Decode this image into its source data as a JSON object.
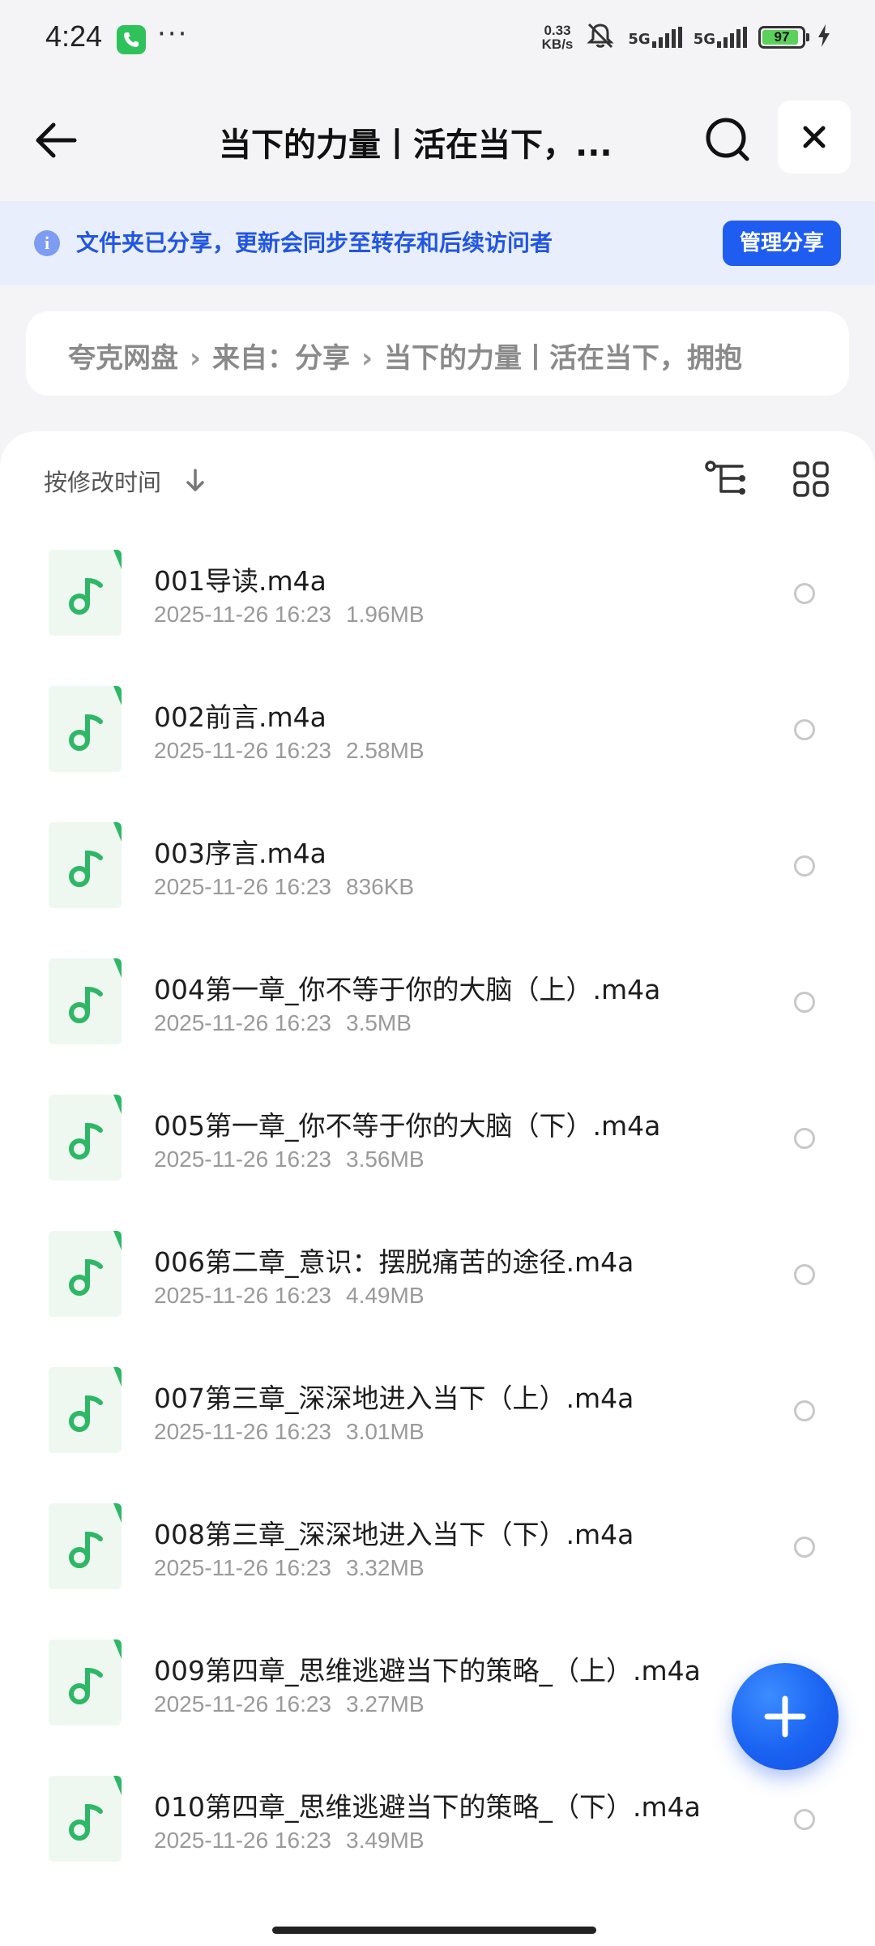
{
  "status_bar": {
    "time": "4:24",
    "dots": "···",
    "net_speed_value": "0.33",
    "net_speed_unit": "KB/s",
    "sim1_label": "5G",
    "sim2_label": "5G",
    "battery_level": "97",
    "icons": [
      "phone-call-icon",
      "mute-bell-icon",
      "signal-icon",
      "battery-icon",
      "charging-bolt-icon"
    ]
  },
  "header": {
    "title": "当下的力量丨活在当下，...",
    "back_icon": "arrow-left-icon",
    "search_icon": "search-icon",
    "close_icon": "close-icon"
  },
  "share_banner": {
    "message": "文件夹已分享，更新会同步至转存和后续访问者",
    "button_label": "管理分享"
  },
  "breadcrumb": {
    "items": [
      "夸克网盘",
      "来自：分享",
      "当下的力量丨活在当下，拥抱"
    ],
    "separator": "›"
  },
  "list": {
    "sort_label": "按修改时间",
    "files": [
      {
        "name": "001导读.m4a",
        "date": "2025-11-26 16:23",
        "size": "1.96MB"
      },
      {
        "name": "002前言.m4a",
        "date": "2025-11-26 16:23",
        "size": "2.58MB"
      },
      {
        "name": "003序言.m4a",
        "date": "2025-11-26 16:23",
        "size": "836KB"
      },
      {
        "name": "004第一章_你不等于你的大脑（上）.m4a",
        "date": "2025-11-26 16:23",
        "size": "3.5MB"
      },
      {
        "name": "005第一章_你不等于你的大脑（下）.m4a",
        "date": "2025-11-26 16:23",
        "size": "3.56MB"
      },
      {
        "name": "006第二章_意识：摆脱痛苦的途径.m4a",
        "date": "2025-11-26 16:23",
        "size": "4.49MB"
      },
      {
        "name": "007第三章_深深地进入当下（上）.m4a",
        "date": "2025-11-26 16:23",
        "size": "3.01MB"
      },
      {
        "name": "008第三章_深深地进入当下（下）.m4a",
        "date": "2025-11-26 16:23",
        "size": "3.32MB"
      },
      {
        "name": "009第四章_思维逃避当下的策略_（上）.m4a",
        "date": "2025-11-26 16:23",
        "size": "3.27MB"
      },
      {
        "name": "010第四章_思维逃避当下的策略_（下）.m4a",
        "date": "2025-11-26 16:23",
        "size": "3.49MB"
      }
    ]
  },
  "colors": {
    "accent": "#1f5cf0",
    "audio_icon_green": "#2eb766",
    "banner_bg": "#e9eefd"
  }
}
